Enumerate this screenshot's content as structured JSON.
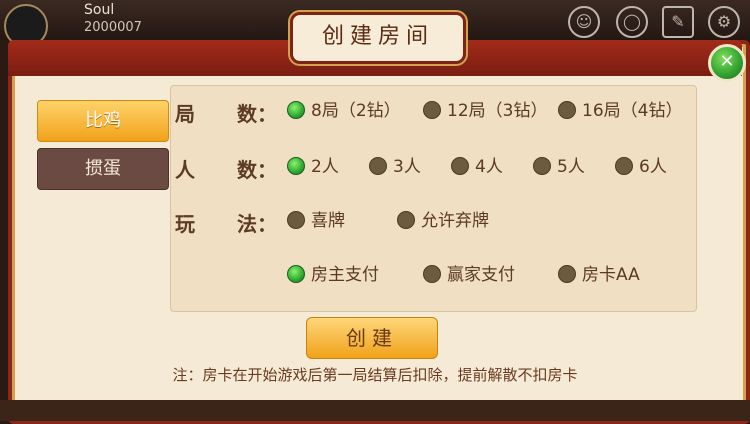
{
  "header": {
    "player_name": "Soul",
    "player_id": "2000007"
  },
  "dialog": {
    "title": "创建房间",
    "close_symbol": "✕"
  },
  "tabs": [
    {
      "label": "比鸡",
      "active": true
    },
    {
      "label": "掼蛋",
      "active": false
    }
  ],
  "options": {
    "rounds": {
      "label_a": "局",
      "label_b": "数：",
      "items": [
        {
          "text": "8局（2钻）",
          "selected": true
        },
        {
          "text": "12局（3钻）",
          "selected": false
        },
        {
          "text": "16局（4钻）",
          "selected": false
        }
      ]
    },
    "players": {
      "label_a": "人",
      "label_b": "数：",
      "items": [
        {
          "text": "2人",
          "selected": true
        },
        {
          "text": "3人",
          "selected": false
        },
        {
          "text": "4人",
          "selected": false
        },
        {
          "text": "5人",
          "selected": false
        },
        {
          "text": "6人",
          "selected": false
        }
      ]
    },
    "rules": {
      "label_a": "玩",
      "label_b": "法：",
      "items": [
        {
          "text": "喜牌",
          "selected": false
        },
        {
          "text": "允许弃牌",
          "selected": false
        }
      ]
    },
    "payment": {
      "items": [
        {
          "text": "房主支付",
          "selected": true
        },
        {
          "text": "赢家支付",
          "selected": false
        },
        {
          "text": "房卡AA",
          "selected": false
        }
      ]
    }
  },
  "create_button": "创建",
  "note": "注：房卡在开始游戏后第一局结算后扣除，提前解散不扣房卡",
  "colors": {
    "dialog_border": "#8e2618",
    "panel_bg": "#f0dfc2",
    "active_tab": "#f0a21a",
    "selected_radio": "#2ea833"
  }
}
